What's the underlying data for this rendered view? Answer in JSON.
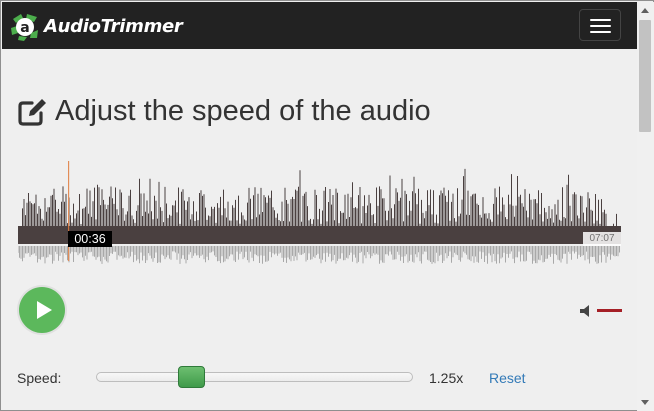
{
  "app": {
    "brand_name": "AudioTrimmer",
    "brand_color": "#5cb85c"
  },
  "navbar": {
    "menu_icon": "hamburger-menu-icon"
  },
  "page": {
    "heading": "Adjust the speed of the audio",
    "heading_icon": "edit-icon"
  },
  "player": {
    "current_time": "00:36",
    "total_time": "07:07",
    "playhead_fraction": 0.084,
    "play_icon": "play-icon",
    "volume_icon": "speaker-icon",
    "volume_bar_color": "#a51f26",
    "play_button_color": "#5cb85c"
  },
  "speed": {
    "label": "Speed:",
    "value": "1.25x",
    "reset_label": "Reset",
    "slider_fraction": 0.3,
    "link_color": "#337ab7"
  }
}
